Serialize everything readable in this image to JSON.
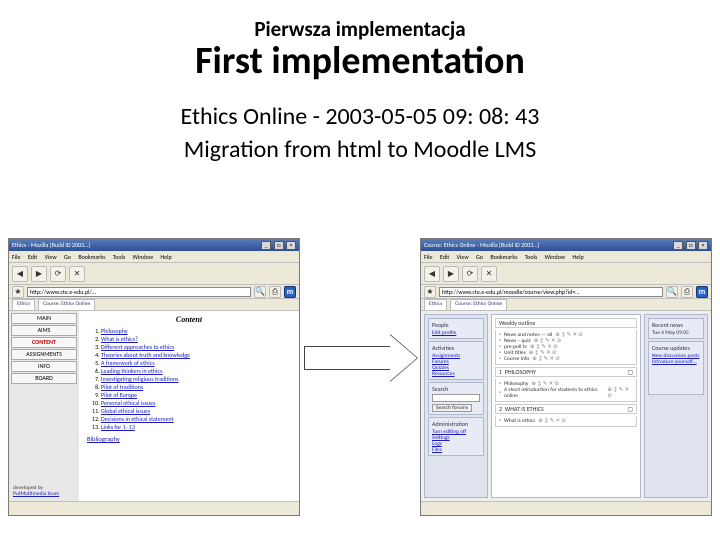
{
  "slide": {
    "subtitle_small": "Pierwsza implementacja",
    "title": "First implementation",
    "line1": "Ethics Online - 2003-05-05 09: 08: 43",
    "line2": "Migration from html to Moodle LMS"
  },
  "left_shot": {
    "window_title": "Ethics - Mozilla {Build ID 2003…}",
    "win_min": "_",
    "win_max": "□",
    "win_close": "×",
    "menu": {
      "file": "File",
      "edit": "Edit",
      "view": "View",
      "go": "Go",
      "bookmarks": "Bookmarks",
      "tools": "Tools",
      "window": "Window",
      "help": "Help"
    },
    "url": "http://www.cte.e-edu.pl/…",
    "nav": {
      "main": "MAIN",
      "aims": "AIMS",
      "content": "CONTENT",
      "assign": "ASSIGNMENTS",
      "info": "INFO",
      "board": "BOARD"
    },
    "content_heading": "Content",
    "items": [
      "Philosophy",
      "What is ethics?",
      "Different approaches to ethics",
      "Theories about truth and knowledge",
      "A framework of ethics",
      "Leading thinkers in ethics",
      "Investigating religious traditions",
      "Pilot of traditions",
      "Pilot of Europe",
      "Personal ethical issues",
      "Global ethical issues",
      "Decisions in ethical statement",
      "Links for 1–13"
    ],
    "bibliography": "Bibliography",
    "dev_note_1": "developed by",
    "dev_note_2": "PutMultimedia team"
  },
  "right_shot": {
    "window_title": "Course: Ethics Online - Mozilla {Build ID 2003…}",
    "win_min": "_",
    "win_max": "□",
    "win_close": "×",
    "menu": {
      "file": "File",
      "edit": "Edit",
      "view": "View",
      "go": "Go",
      "bookmarks": "Bookmarks",
      "tools": "Tools",
      "window": "Window",
      "help": "Help"
    },
    "url": "http://www.cte.e-edu.pl/moodle/course/view.php?id=…",
    "tab1": "Ethics",
    "tab2": "Course: Ethics Online",
    "left_col": {
      "people_hd": "People",
      "people_link": "Edit profile",
      "activities_hd": "Activities",
      "act1": "Assignments",
      "act2": "Forums",
      "act3": "Quizzes",
      "act4": "Resources",
      "search_hd": "Search",
      "search_btn": "Search forums",
      "admin_hd": "Administration",
      "adm1": "Turn editing off",
      "adm2": "Settings",
      "adm3": "Logs",
      "adm4": "Files"
    },
    "center": {
      "wk0_hd": "Weekly outline",
      "wk0_i1": "News and notes — all",
      "wk0_i2": "News – quiz",
      "wk0_i3": "pre-poll tv",
      "wk0_i4": "Unit titles",
      "wk0_i5": "Course info",
      "glyphs": "⊕ ↕ ✎ ✕ ⊘",
      "wk1_num": "1",
      "wk1_title": "PHILOSOPHY",
      "wk1_i1": "Philosophy",
      "wk1_i2": "A short introduction for students to ethics online",
      "wk2_num": "2",
      "wk2_title": "WHAT IS ETHICS",
      "wk2_i1": "What is ethics"
    },
    "right_col": {
      "news_hd": "Recent news",
      "news_body": "Tue 6 May 09:05",
      "updates_hd": "Course updates",
      "upd1": "New discussion posts",
      "upd2": "Introduce yourself…"
    }
  }
}
